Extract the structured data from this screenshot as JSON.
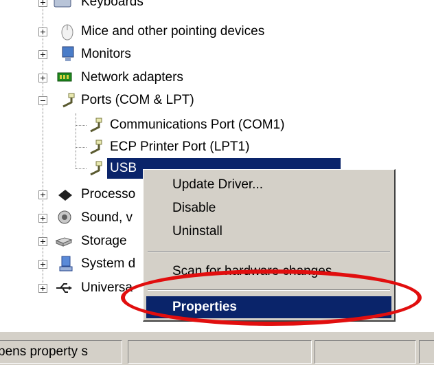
{
  "tree": {
    "items": [
      {
        "label": "Keyboards"
      },
      {
        "label": "Mice and other pointing devices"
      },
      {
        "label": "Monitors"
      },
      {
        "label": "Network adapters"
      },
      {
        "label": "Ports (COM & LPT)"
      },
      {
        "label": "Communications Port (COM1)"
      },
      {
        "label": "ECP Printer Port (LPT1)"
      },
      {
        "label": "USB"
      },
      {
        "label": "Processo"
      },
      {
        "label": "Sound, v"
      },
      {
        "label": "Storage"
      },
      {
        "label": "System d"
      },
      {
        "label": "Universa"
      }
    ]
  },
  "context_menu": {
    "update_driver": "Update Driver...",
    "disable": "Disable",
    "uninstall": "Uninstall",
    "scan": "Scan for hardware changes",
    "properties": "Properties"
  },
  "statusbar": {
    "text": "pens property s"
  },
  "colors": {
    "selection": "#0a246a",
    "menu_bg": "#d4d0c8",
    "annotation": "#e10e0e"
  }
}
